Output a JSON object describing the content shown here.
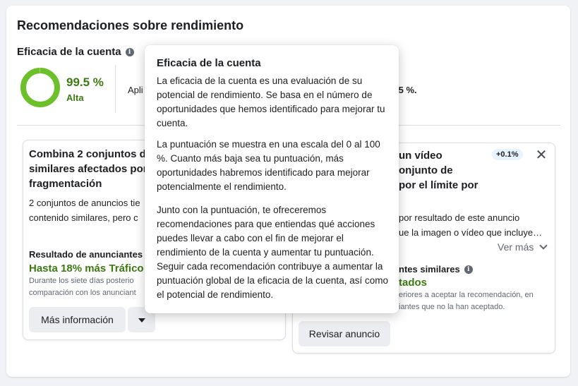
{
  "page": {
    "title": "Recomendaciones sobre rendimiento"
  },
  "score": {
    "title": "Eficacia de la cuenta",
    "value_text": "99.5 %",
    "percent": 99.5,
    "rating": "Alta",
    "apply_prefix": "Apli",
    "apply_suffix": ".5 %.",
    "ring_color": "#6cc12a",
    "ring_track_color": "#dadde1"
  },
  "cards": [
    {
      "title": "Combina 2 conjuntos de anuncios similares afectados por la fragmentación",
      "title_lines": [
        "Combina 2 conjuntos de",
        "similares afectados por",
        "fragmentación"
      ],
      "desc_lines": [
        "2 conjuntos de anuncios tie",
        "contenido similares, pero c"
      ],
      "result_label": "Resultado de anunciantes",
      "result_value": "Hasta 18% más Tráfico",
      "note_lines": [
        "Durante los siete días posterio",
        "comparación con los anunciant"
      ],
      "primary_button": "Más información",
      "secondary_icon": "caret-down-icon"
    },
    {
      "title_lines": [
        "un vídeo",
        "onjunto de",
        "por el límite por"
      ],
      "badge": "+0.1%",
      "close_icon": "close-icon",
      "desc_lines": [
        "por resultado de este anuncio",
        "ue la imagen o vídeo que incluye…"
      ],
      "see_more": "Ver más",
      "result_label": "ntes similares",
      "result_value": "tados",
      "note_lines": [
        "eriores a aceptar la recomendación, en",
        "iantes que no la han aceptado."
      ],
      "primary_button": "Revisar anuncio"
    }
  ],
  "tooltip": {
    "title": "Eficacia de la cuenta",
    "paragraphs": [
      "La eficacia de la cuenta es una evaluación de su potencial de rendimiento. Se basa en el número de oportunidades que hemos identificado para mejorar tu cuenta.",
      "La puntuación se muestra en una escala del 0 al 100 %. Cuanto más baja sea tu puntuación, más oportunidades habremos identificado para mejorar potencialmente el rendimiento.",
      "Junto con la puntuación, te ofreceremos recomendaciones para que entiendas qué acciones puedes llevar a cabo con el fin de mejorar el rendimiento de la cuenta y aumentar tu puntuación. Seguir cada recomendación contribuye a aumentar la puntuación global de la eficacia de la cuenta, así como el potencial de rendimiento."
    ]
  }
}
